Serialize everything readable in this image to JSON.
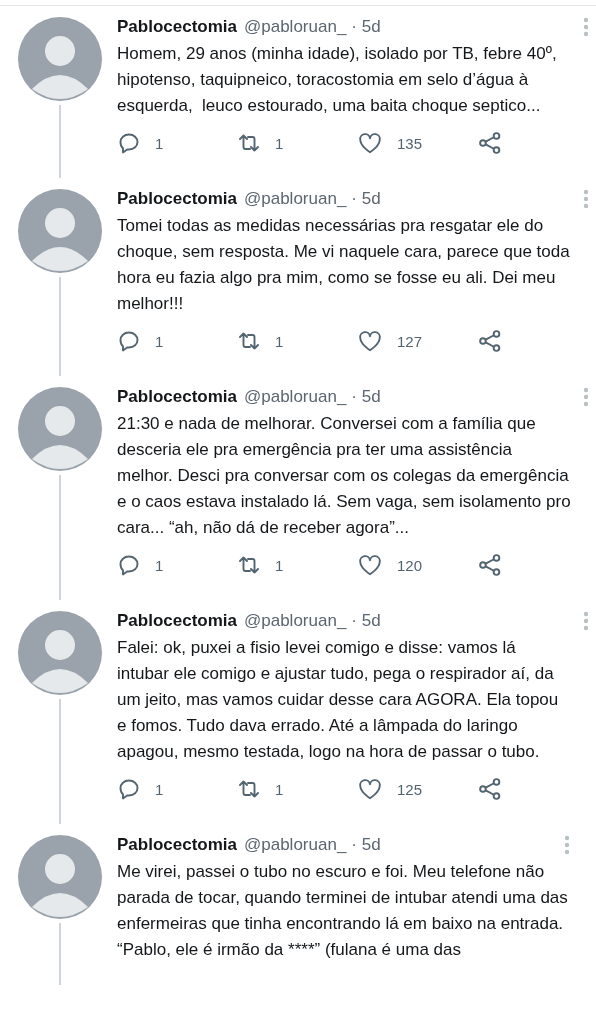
{
  "tweets": [
    {
      "name": "Pablocectomia",
      "handle": "@pabloruan_",
      "time": "· 5d",
      "text": "Homem, 29 anos (minha idade), isolado por TB, febre 40º, hipotenso, taquipneico, toracostomia em selo d’água à esquerda,  leuco estourado, uma baita choque septico...",
      "replies": "1",
      "retweets": "1",
      "likes": "135"
    },
    {
      "name": "Pablocectomia",
      "handle": "@pabloruan_",
      "time": "· 5d",
      "text": "Tomei todas as medidas necessárias pra resgatar ele do choque, sem resposta. Me vi naquele cara, parece que toda hora eu fazia algo pra mim, como se fosse eu ali. Dei meu melhor!!!",
      "replies": "1",
      "retweets": "1",
      "likes": "127"
    },
    {
      "name": "Pablocectomia",
      "handle": "@pabloruan_",
      "time": "· 5d",
      "text": "21:30 e nada de melhorar. Conversei com a família que desceria ele pra emergência pra ter uma assistência melhor. Desci pra conversar com os colegas da emergência e o caos estava instalado lá. Sem vaga, sem isolamento pro cara... “ah, não dá de receber agora”...",
      "replies": "1",
      "retweets": "1",
      "likes": "120"
    },
    {
      "name": "Pablocectomia",
      "handle": "@pabloruan_",
      "time": "· 5d",
      "text": "Falei: ok, puxei a fisio levei comigo e disse: vamos lá intubar ele comigo e ajustar tudo, pega o respirador aí, da um jeito, mas vamos cuidar desse cara AGORA. Ela topou e fomos. Tudo dava errado. Até a lâmpada do laringo apagou, mesmo testada, logo na hora de passar o tubo.",
      "replies": "1",
      "retweets": "1",
      "likes": "125"
    },
    {
      "name": "Pablocectomia",
      "handle": "@pabloruan_",
      "time": "· 5d",
      "text": "Me virei, passei o tubo no escuro e foi. Meu telefone não parada de tocar, quando terminei de intubar atendi uma das enfermeiras que tinha encontrando lá em baixo na entrada.\n“Pablo, ele é irmão da ****” (fulana é uma das"
    }
  ]
}
